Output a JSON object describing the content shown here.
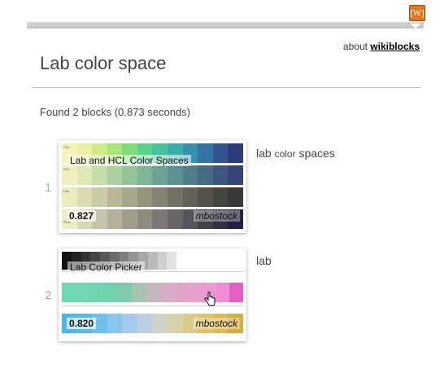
{
  "logo": {
    "text": "[W]"
  },
  "header": {
    "about_prefix": "about",
    "about_link": "wikiblocks"
  },
  "search": {
    "title": "Lab color space",
    "summary": "Found 2 blocks (0.873 seconds)"
  },
  "results": [
    {
      "rank": "1",
      "title_prefix": "lab ",
      "title_small": "color",
      "title_suffix": " spaces",
      "thumb_title": "Lab and HCL Color Spaces",
      "score": "0.827",
      "author": "mbostock",
      "row_labels": [
        "HSL",
        "HCL",
        "Lab",
        "RGB"
      ]
    },
    {
      "rank": "2",
      "title": "lab",
      "thumb_title": "Lab Color Picker",
      "score": "0.820",
      "author": "mbostock"
    }
  ],
  "colors": {
    "accent_logo": "#e07a22",
    "row_hsl": [
      "#f6f3b9",
      "#e9f0a1",
      "#d0ec8a",
      "#a9e67a",
      "#7fdc7a",
      "#5bd08a",
      "#47c29a",
      "#3aaea8",
      "#3493aa",
      "#3474a3",
      "#335493",
      "#2f3c7a"
    ],
    "row_hcl": [
      "#f1efbf",
      "#dde8b3",
      "#c5dda9",
      "#acd1a1",
      "#95c39a",
      "#7fb497",
      "#6ca394",
      "#5c9190",
      "#4f7e8b",
      "#456b85",
      "#3d577c",
      "#344573"
    ],
    "row_lab": [
      "#ececc0",
      "#dcdcb2",
      "#cbcba5",
      "#b9b998",
      "#a7a78b",
      "#95957e",
      "#838371",
      "#727264",
      "#626258",
      "#53534c",
      "#454540",
      "#383836"
    ],
    "row_rgb": [
      "#ededc4",
      "#dad9b6",
      "#c7c5a9",
      "#b4b19b",
      "#a19e8e",
      "#8e8b81",
      "#7b7874",
      "#686567",
      "#55535b",
      "#44414f",
      "#342f44",
      "#262040"
    ],
    "pick_gray": [
      "#111111",
      "#222222",
      "#333333",
      "#454545",
      "#585858",
      "#6b6b6b",
      "#7f7f7f",
      "#939393",
      "#a7a7a7",
      "#bbbbbb",
      "#cfcfcf",
      "#e3e3e3"
    ],
    "pick_a": [
      "#6fd7b3",
      "#6fd7b3",
      "#6fd4b0",
      "#6fd1ae",
      "#7fcbae",
      "#a6c3b4",
      "#c3b8bd",
      "#d4aec4",
      "#e0a6c9",
      "#e8a0cc",
      "#ee9ad0",
      "#f08ed4",
      "#e45fc3"
    ],
    "pick_b": [
      "#48b8e8",
      "#57bcec",
      "#6ec1ee",
      "#89c6ef",
      "#a4cbee",
      "#bccfe2",
      "#cdd3c9",
      "#d7d2a9",
      "#dccb88",
      "#ddc46b",
      "#ddbb52",
      "#d6ae3c"
    ]
  }
}
